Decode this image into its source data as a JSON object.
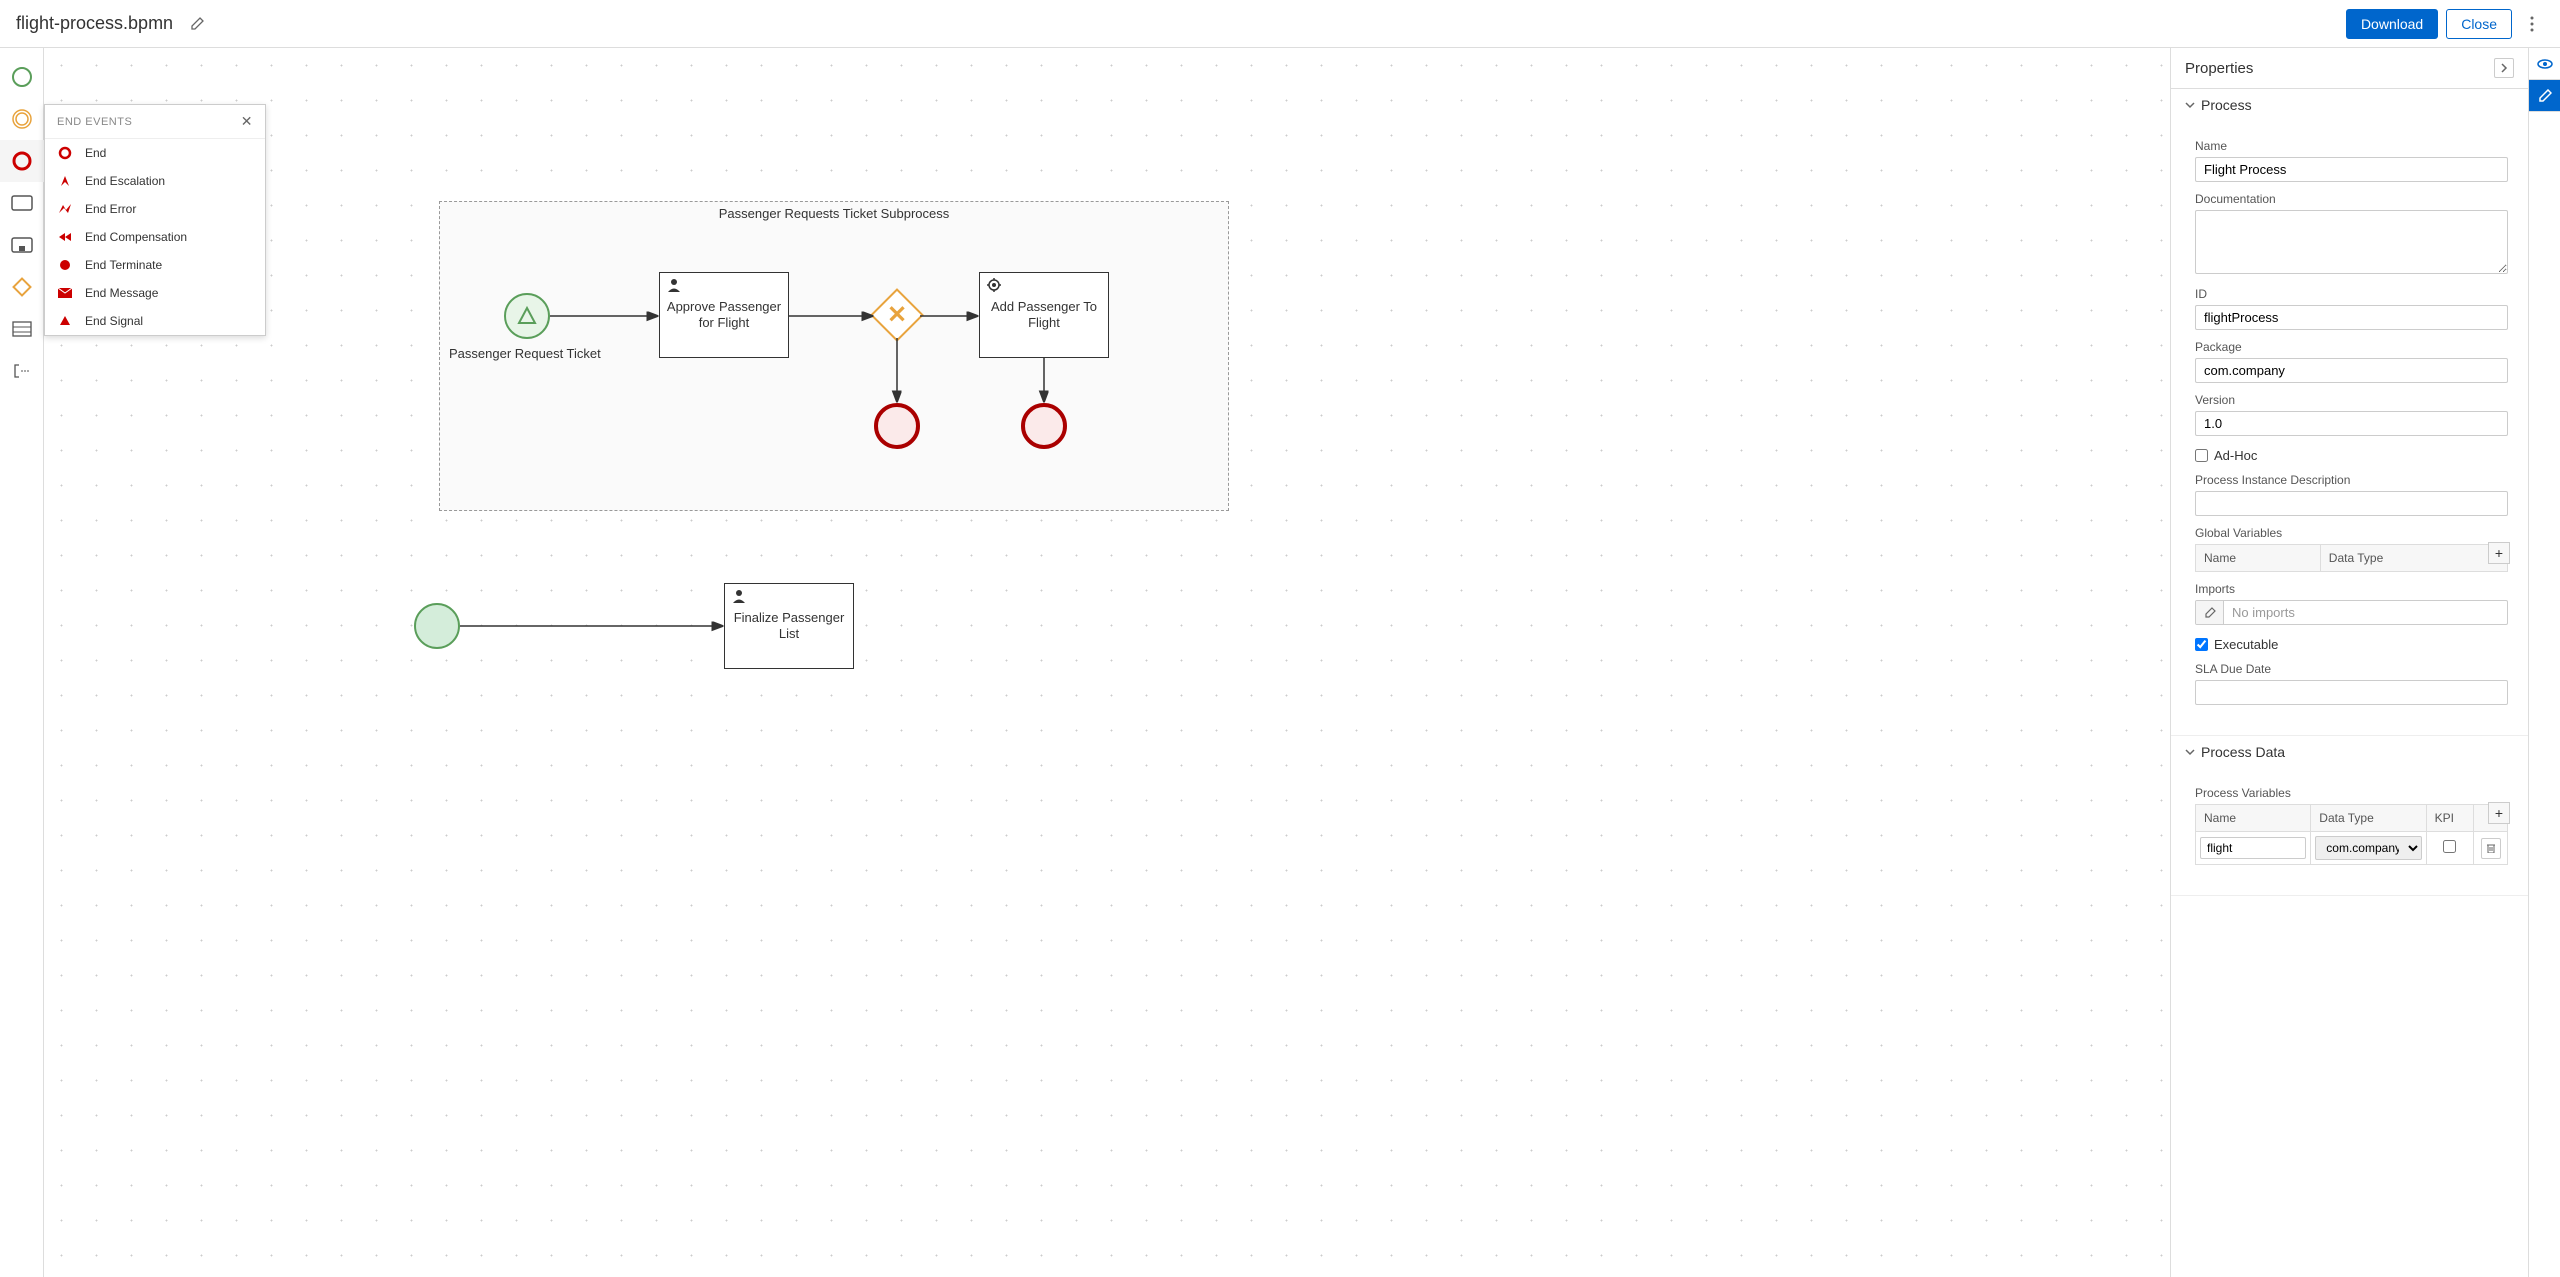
{
  "header": {
    "file_name": "flight-process.bpmn",
    "download_label": "Download",
    "close_label": "Close"
  },
  "palette": {
    "title": "END EVENTS",
    "items": [
      {
        "icon": "circle",
        "label": "End"
      },
      {
        "icon": "escalation",
        "label": "End Escalation"
      },
      {
        "icon": "error",
        "label": "End Error"
      },
      {
        "icon": "compensation",
        "label": "End Compensation"
      },
      {
        "icon": "terminate",
        "label": "End Terminate"
      },
      {
        "icon": "message",
        "label": "End Message"
      },
      {
        "icon": "signal",
        "label": "End Signal"
      }
    ]
  },
  "canvas": {
    "subprocess_label": "Passenger Requests Ticket Subprocess",
    "start_signal_label": "Passenger Request Ticket",
    "task_approve": "Approve Passenger for Flight",
    "task_add": "Add Passenger To Flight",
    "task_finalize": "Finalize Passenger List"
  },
  "properties": {
    "panel_title": "Properties",
    "section_process": "Process",
    "name_label": "Name",
    "name_value": "Flight Process",
    "doc_label": "Documentation",
    "doc_value": "",
    "id_label": "ID",
    "id_value": "flightProcess",
    "package_label": "Package",
    "package_value": "com.company",
    "version_label": "Version",
    "version_value": "1.0",
    "adhoc_label": "Ad-Hoc",
    "adhoc_checked": false,
    "pid_label": "Process Instance Description",
    "pid_value": "",
    "globals_label": "Global Variables",
    "globals_cols": {
      "name": "Name",
      "dtype": "Data Type"
    },
    "imports_label": "Imports",
    "imports_placeholder": "No imports",
    "exec_label": "Executable",
    "exec_checked": true,
    "sla_label": "SLA Due Date",
    "sla_value": "",
    "section_pdata": "Process Data",
    "pvars_label": "Process Variables",
    "pvars_cols": {
      "name": "Name",
      "dtype": "Data Type",
      "kpi": "KPI"
    },
    "pvars_row": {
      "name": "flight",
      "dtype": "com.company",
      "kpi": false
    }
  }
}
